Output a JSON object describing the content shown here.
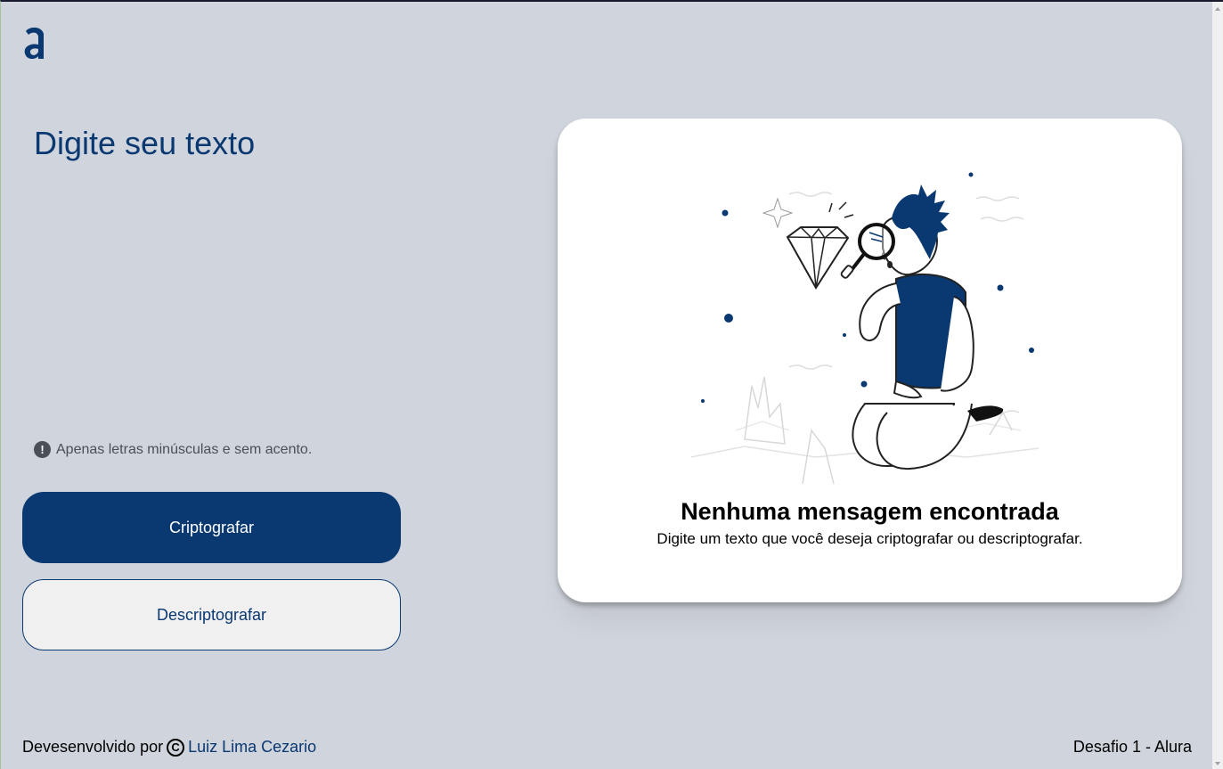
{
  "app": {
    "accent_color": "#0A3871",
    "background_color": "#D0D4DC"
  },
  "logo": {
    "icon": "alura-logo-icon"
  },
  "input": {
    "placeholder": "Digite seu texto",
    "value": ""
  },
  "hint": {
    "icon": "exclamation-circle-icon",
    "text": "Apenas letras minúsculas e sem acento."
  },
  "buttons": {
    "encrypt_label": "Criptografar",
    "decrypt_label": "Descriptografar"
  },
  "output": {
    "illustration": "person-searching-diamond-illustration",
    "title": "Nenhuma mensagem encontrada",
    "subtitle": "Digite um texto que você deseja criptografar ou descriptografar."
  },
  "footer": {
    "developed_by": "Devesenvolvido por",
    "copyright_icon": "copyright-icon",
    "author": "Luiz Lima Cezario",
    "challenge": "Desafio 1 - Alura"
  }
}
